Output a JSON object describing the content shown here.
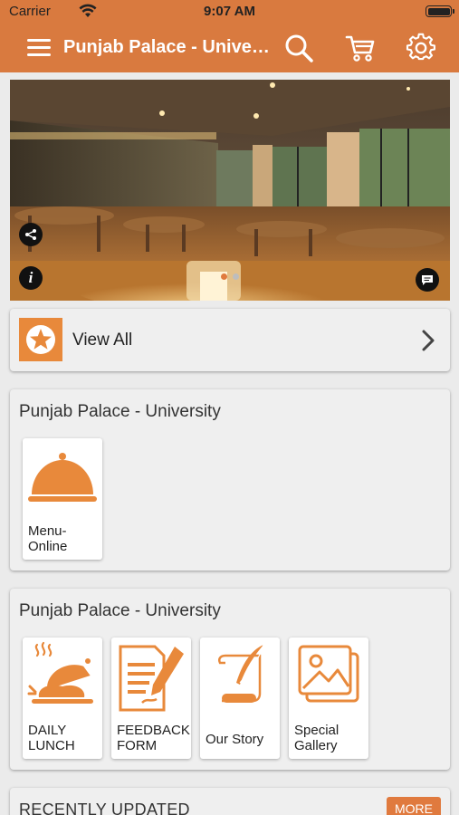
{
  "status_bar": {
    "carrier": "Carrier",
    "time": "9:07 AM"
  },
  "nav": {
    "title": "Punjab Palace - University",
    "icons": [
      "menu-icon",
      "search-icon",
      "cart-icon",
      "gear-icon"
    ],
    "color": "#d97a3f"
  },
  "hero": {
    "overlay_icons": [
      "share-icon",
      "info-icon",
      "chat-icon"
    ],
    "slide_count": 2,
    "active_slide": 1
  },
  "view_all": {
    "label": "View All",
    "icon": "star-icon"
  },
  "section1": {
    "title": "Punjab Palace - University",
    "tiles": [
      {
        "label": "Menu-Online",
        "line1": "Menu-",
        "line2": "Online",
        "icon": "cloche-icon"
      }
    ]
  },
  "section2": {
    "title": "Punjab Palace - University",
    "tiles": [
      {
        "line1": "DAILY",
        "line2": "LUNCH",
        "icon": "hot-food-icon"
      },
      {
        "line1": "FEEDBACK",
        "line2": "FORM",
        "icon": "feedback-form-icon"
      },
      {
        "line1": "Our Story",
        "line2": "",
        "icon": "quill-scroll-icon"
      },
      {
        "line1": "Special",
        "line2": "Gallery",
        "icon": "gallery-icon"
      }
    ]
  },
  "recent": {
    "title": "RECENTLY UPDATED",
    "more_label": "MORE"
  },
  "accent_color": "#e8893b"
}
